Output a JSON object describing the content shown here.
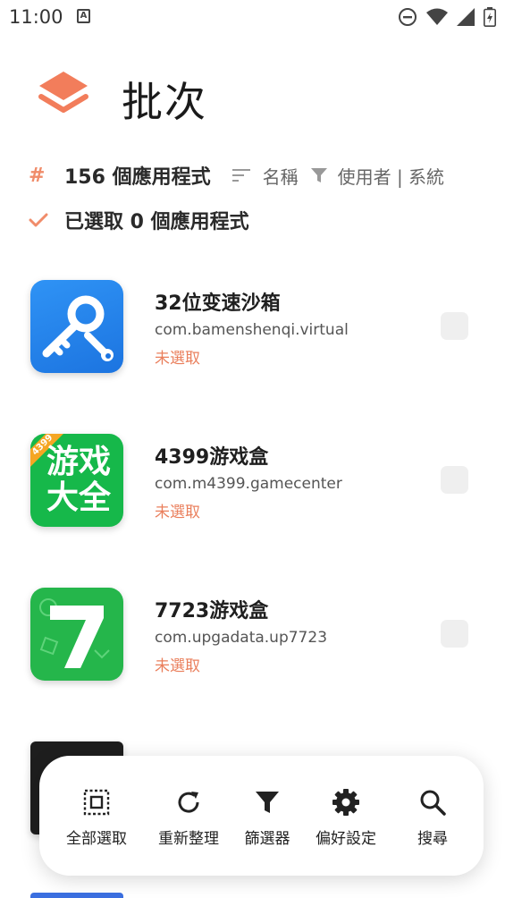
{
  "status_bar": {
    "time": "11:00",
    "notification_letter": "A"
  },
  "header": {
    "title": "批次",
    "accent_color": "#f27d5b"
  },
  "info": {
    "app_count": "156 個應用程式",
    "sort_label": "名稱",
    "filter_label": "使用者 | 系統",
    "selected_count": "已選取 0 個應用程式"
  },
  "apps": [
    {
      "name": "32位变速沙箱",
      "package": "com.bamenshenqi.virtual",
      "status": "未選取",
      "icon": "key-wrench-icon",
      "checked": false
    },
    {
      "name": "4399游戏盒",
      "package": "com.m4399.gamecenter",
      "status": "未選取",
      "icon": "4399-game-icon",
      "icon_text_top": "游戏",
      "icon_text_bottom": "大全",
      "icon_badge": "4399",
      "checked": false
    },
    {
      "name": "7723游戏盒",
      "package": "com.upgadata.up7723",
      "status": "未選取",
      "icon": "7723-icon",
      "icon_text": "7",
      "checked": false
    }
  ],
  "toolbar": {
    "select_all": "全部選取",
    "refresh": "重新整理",
    "filter": "篩選器",
    "preferences": "偏好設定",
    "search": "搜尋"
  }
}
